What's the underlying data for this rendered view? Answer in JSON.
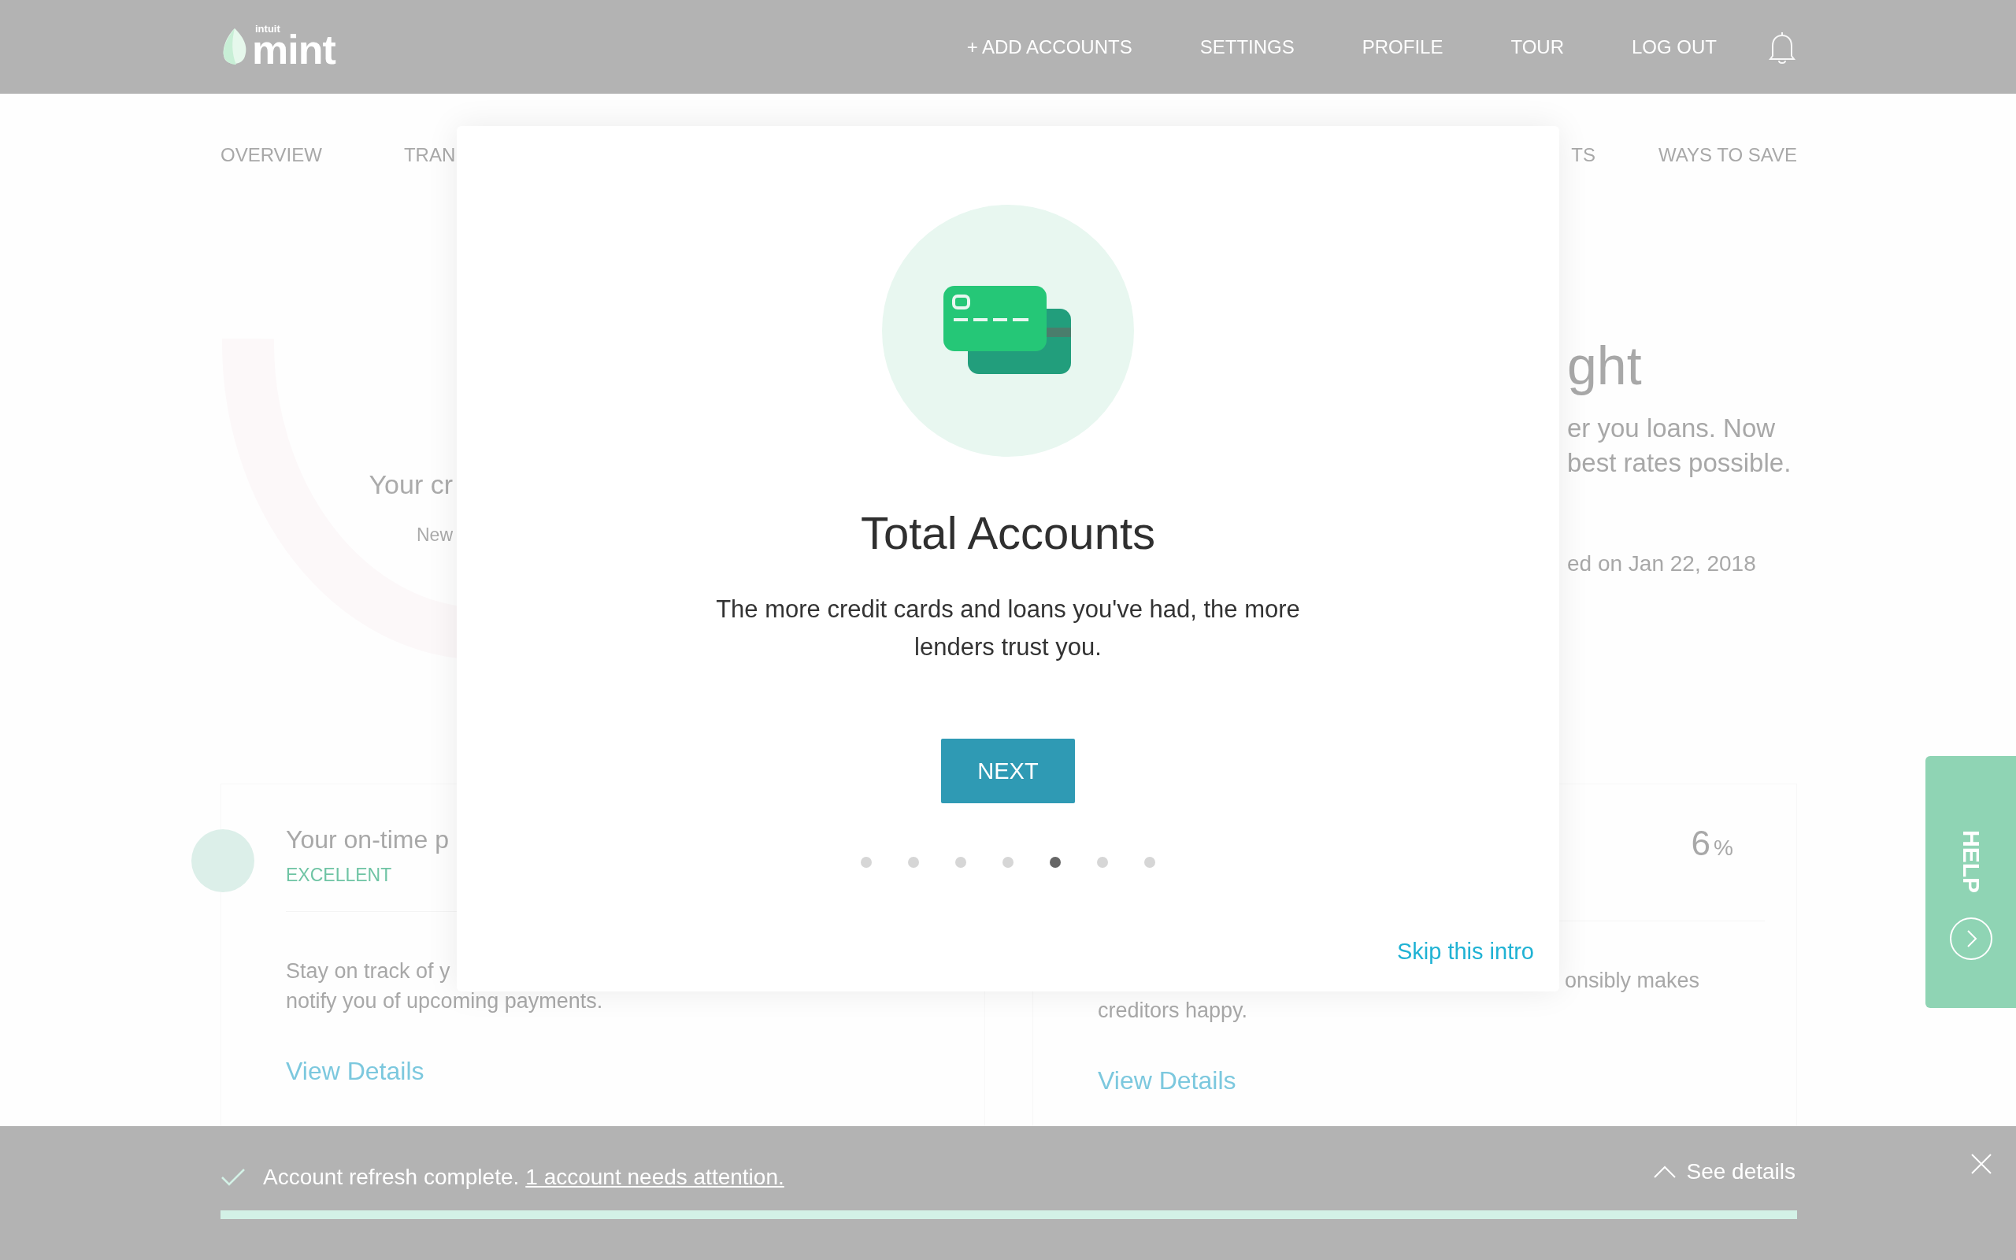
{
  "header": {
    "logo": {
      "brand": "intuit",
      "name": "mint"
    },
    "nav": [
      {
        "label": "+ ADD ACCOUNTS"
      },
      {
        "label": "SETTINGS"
      },
      {
        "label": "PROFILE"
      },
      {
        "label": "TOUR"
      },
      {
        "label": "LOG OUT"
      }
    ]
  },
  "subnav": {
    "left": [
      "OVERVIEW",
      "TRAN"
    ],
    "right": [
      "TS",
      "WAYS TO SAVE"
    ]
  },
  "score": {
    "subtitle": "Your cr",
    "note": "New"
  },
  "insight": {
    "title": "ght",
    "lines": [
      "er you loans. Now",
      "best rates possible."
    ],
    "updated": "ed on Jan 22, 2018"
  },
  "cards": [
    {
      "title": "Your on-time p",
      "rating": "EXCELLENT",
      "lines": [
        "Stay on track of y",
        "notify you of upcoming payments."
      ],
      "link": "View Details"
    },
    {
      "value": "6",
      "unit": "%",
      "lines": [
        "onsibly makes",
        "creditors happy."
      ],
      "link": "View Details"
    }
  ],
  "help_tab": {
    "label": "HELP"
  },
  "modal": {
    "title": "Total Accounts",
    "body": "The more credit cards and loans you've had, the more lenders trust you.",
    "button": "NEXT",
    "steps": [
      {
        "selected": false
      },
      {
        "selected": false
      },
      {
        "selected": false
      },
      {
        "selected": false
      },
      {
        "selected": true
      },
      {
        "selected": false
      },
      {
        "selected": false
      }
    ],
    "skip": "Skip this intro"
  },
  "notification": {
    "message": "Account refresh complete.",
    "link": "1 account needs attention.",
    "details": "See details",
    "progress": {
      "level": 1
    }
  }
}
